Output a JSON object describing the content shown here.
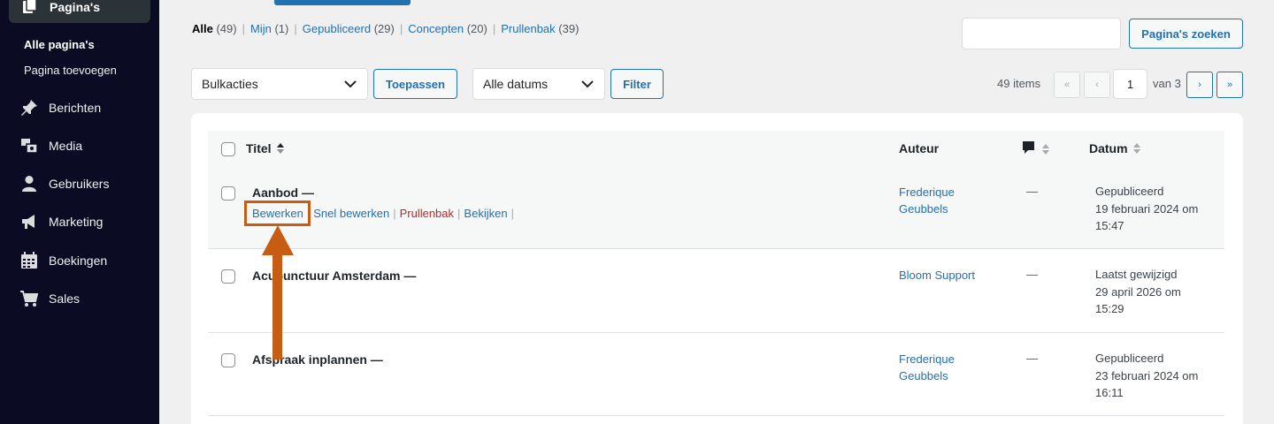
{
  "sidebar": {
    "current": {
      "label": "Pagina's",
      "icon": "pages-icon"
    },
    "subitems": [
      {
        "label": "Alle pagina's",
        "active": true
      },
      {
        "label": "Pagina toevoegen",
        "active": false
      }
    ],
    "items": [
      {
        "label": "Berichten",
        "icon": "pin-icon"
      },
      {
        "label": "Media",
        "icon": "media-icon"
      },
      {
        "label": "Gebruikers",
        "icon": "user-icon"
      },
      {
        "label": "Marketing",
        "icon": "megaphone-icon"
      },
      {
        "label": "Boekingen",
        "icon": "calendar-icon"
      },
      {
        "label": "Sales",
        "icon": "cart-icon"
      }
    ]
  },
  "filters": {
    "all": {
      "label": "Alle",
      "count": "(49)"
    },
    "mine": {
      "label": "Mijn",
      "count": "(1)"
    },
    "published": {
      "label": "Gepubliceerd",
      "count": "(29)"
    },
    "drafts": {
      "label": "Concepten",
      "count": "(20)"
    },
    "trash": {
      "label": "Prullenbak",
      "count": "(39)"
    }
  },
  "search": {
    "button": "Pagina's zoeken",
    "value": ""
  },
  "bulk": {
    "selected": "Bulkacties",
    "apply": "Toepassen"
  },
  "dates": {
    "selected": "Alle datums",
    "filter": "Filter"
  },
  "pagination": {
    "items": "49 items",
    "first": "«",
    "prev": "‹",
    "current": "1",
    "of": "van 3",
    "next": "›",
    "last": "»"
  },
  "table": {
    "headers": {
      "title": "Titel",
      "author": "Auteur",
      "date": "Datum"
    },
    "rows": [
      {
        "title": "Aanbod —",
        "actions": {
          "edit": "Bewerken",
          "quick_edit": "Snel bewerken",
          "trash": "Prullenbak",
          "view": "Bekijken"
        },
        "author_line1": "Frederique",
        "author_line2": "Geubbels",
        "comments": "—",
        "date_status": "Gepubliceerd",
        "date_line1": "19 februari 2024 om",
        "date_line2": "15:47"
      },
      {
        "title": "Acupunctuur Amsterdam —",
        "author_line1": "Bloom Support",
        "author_line2": "",
        "comments": "—",
        "date_status": "Laatst gewijzigd",
        "date_line1": "29 april 2026 om",
        "date_line2": "15:29"
      },
      {
        "title": "Afspraak inplannen —",
        "author_line1": "Frederique",
        "author_line2": "Geubbels",
        "comments": "—",
        "date_status": "Gepubliceerd",
        "date_line1": "23 februari 2024 om",
        "date_line2": "16:11"
      }
    ]
  },
  "colors": {
    "sidebar_bg": "#0b0c23",
    "link": "#2271b1",
    "trash": "#b32d2e",
    "annotation": "#c75d12"
  }
}
